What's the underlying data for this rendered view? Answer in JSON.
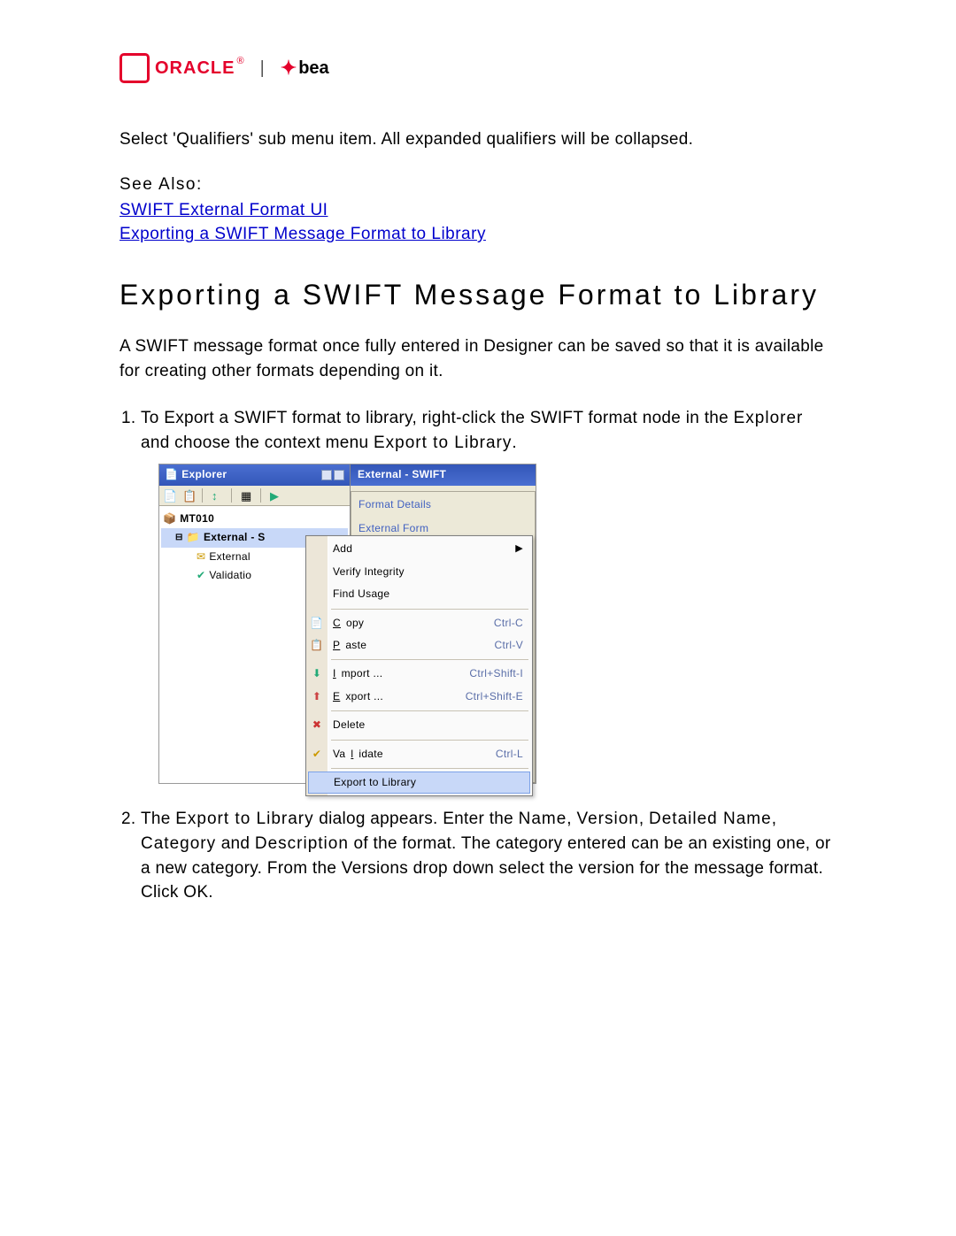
{
  "logo": {
    "oracle": "ORACLE",
    "reg": "®",
    "separator": "|",
    "bea": "bea"
  },
  "intro_text": "Select 'Qualifiers' sub menu item. All expanded qualifiers will be collapsed.",
  "see_also": {
    "label": "See Also:",
    "links": [
      "SWIFT External Format UI",
      "Exporting a SWIFT Message Format to Library"
    ]
  },
  "heading": "Exporting a SWIFT Message Format to Library",
  "lead_paragraph": "A SWIFT message format once fully entered in Designer can be saved so that it is available for creating other formats depending on it.",
  "step1": {
    "prefix": "To Export a SWIFT format to library,  right-click the SWIFT format node in the ",
    "explorer_word": "Explorer",
    "mid": " and choose the context menu ",
    "menu_word": "Export to Library",
    "suffix": "."
  },
  "screenshot": {
    "explorer_title": "Explorer",
    "tree": {
      "root": "MT010",
      "selected": "External - S",
      "child1": "External",
      "child2": "Validatio"
    },
    "right_tab": "External - SWIFT",
    "format_details": "Format Details",
    "external_form": "External Form",
    "context_menu": {
      "sections": [
        [
          {
            "label": "Add",
            "shortcut": "",
            "submenu": true
          },
          {
            "label": "Verify Integrity",
            "shortcut": ""
          },
          {
            "label": "Find Usage",
            "shortcut": ""
          }
        ],
        [
          {
            "label_pre": "",
            "ul": "C",
            "label_post": "opy",
            "shortcut": "Ctrl-C",
            "icon": "copy"
          },
          {
            "label_pre": "",
            "ul": "P",
            "label_post": "aste",
            "shortcut": "Ctrl-V",
            "icon": "paste"
          }
        ],
        [
          {
            "label_pre": "",
            "ul": "I",
            "label_post": "mport ...",
            "shortcut": "Ctrl+Shift-I",
            "icon": "import"
          },
          {
            "label_pre": "",
            "ul": "E",
            "label_post": "xport ...",
            "shortcut": "Ctrl+Shift-E",
            "icon": "export"
          }
        ],
        [
          {
            "label": "Delete",
            "shortcut": "",
            "icon": "delete"
          }
        ],
        [
          {
            "label_pre": "Va",
            "ul": "l",
            "label_post": "idate",
            "shortcut": "Ctrl-L",
            "icon": "validate"
          }
        ],
        [
          {
            "label": "Export to Library",
            "shortcut": "",
            "highlight": true
          }
        ]
      ]
    }
  },
  "step2": {
    "p1": "The ",
    "b1": "Export to Library",
    "p2": " dialog appears. Enter the ",
    "b2": "Name",
    "p3": ", ",
    "b3": "Version",
    "p4": ", ",
    "b4": "Detailed Name",
    "p5": ", ",
    "b5": "Category",
    "p6": " and ",
    "b6": "Description",
    "p7": " of the format. The category entered can be an existing one, or a new category. From the Versions drop down select the version for the message format. Click OK."
  }
}
